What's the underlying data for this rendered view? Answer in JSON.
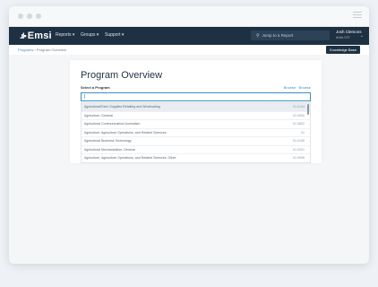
{
  "header": {
    "logo": "Emsi",
    "nav": [
      "Reports",
      "Groups",
      "Support"
    ],
    "search_placeholder": "Jump to a Report",
    "user_name": "Josh Clemons",
    "user_role": "ANALYST"
  },
  "breadcrumb": {
    "parent": "Programs",
    "separator": "›",
    "current": "Program Overview"
  },
  "knowledge_base": "Knowledge Base",
  "main": {
    "title": "Program Overview",
    "select_label": "Select a Program",
    "toggle_browse": "Browse",
    "toggle_separator": "·",
    "toggle_search": "Browse",
    "input_value": "|"
  },
  "programs": [
    {
      "name": "Agricultural/Farm Supplies Retailing and Wholesaling",
      "code": "01.0104"
    },
    {
      "name": "Agriculture, General",
      "code": "01.0000"
    },
    {
      "name": "Agricultural Communication/Journalism",
      "code": "01.0802"
    },
    {
      "name": "Agriculture, Agriculture Operations, and Related Sciences",
      "code": "01"
    },
    {
      "name": "Agricultural Business Technology",
      "code": "01.0106"
    },
    {
      "name": "Agricultural Mechanization, General",
      "code": "01.0201"
    },
    {
      "name": "Agriculture, Agriculture Operations, and Related Sciences, Other",
      "code": "01.9999"
    }
  ]
}
